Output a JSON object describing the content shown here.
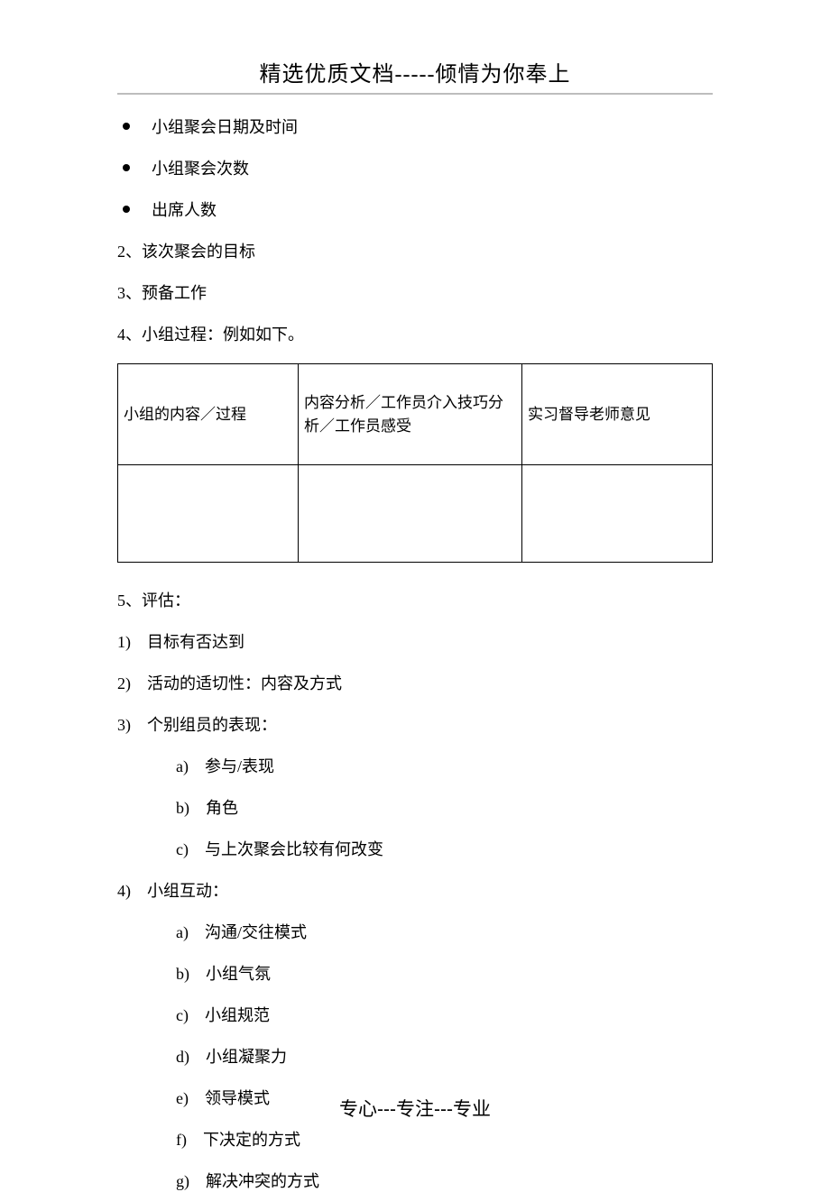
{
  "header": "精选优质文档-----倾情为你奉上",
  "bullets": [
    "小组聚会日期及时间",
    "小组聚会次数",
    "出席人数"
  ],
  "items": {
    "n2": "2、该次聚会的目标",
    "n3": "3、预备工作",
    "n4": "4、小组过程：例如如下。",
    "n5": "5、评估："
  },
  "table": {
    "h1": "小组的内容／过程",
    "h2": "内容分析／工作员介入技巧分析／工作员感受",
    "h3": "实习督导老师意见"
  },
  "evals": {
    "e1": "1)　目标有否达到",
    "e2": "2)　活动的适切性：内容及方式",
    "e3": "3)　个别组员的表现：",
    "e4": "4)　小组互动："
  },
  "sub3": {
    "a": "a)　参与/表现",
    "b": "b)　角色",
    "c": "c)　与上次聚会比较有何改变"
  },
  "sub4": {
    "a": "a)　沟通/交往模式",
    "b": "b)　小组气氛",
    "c": "c)　小组规范",
    "d": "d)　小组凝聚力",
    "e": "e)　领导模式",
    "f": "f)　下决定的方式",
    "g": "g)　解决冲突的方式"
  },
  "footer": {
    "t1": "专心",
    "d1": "---",
    "t2": "专注",
    "d2": "---",
    "t3": "专业"
  }
}
